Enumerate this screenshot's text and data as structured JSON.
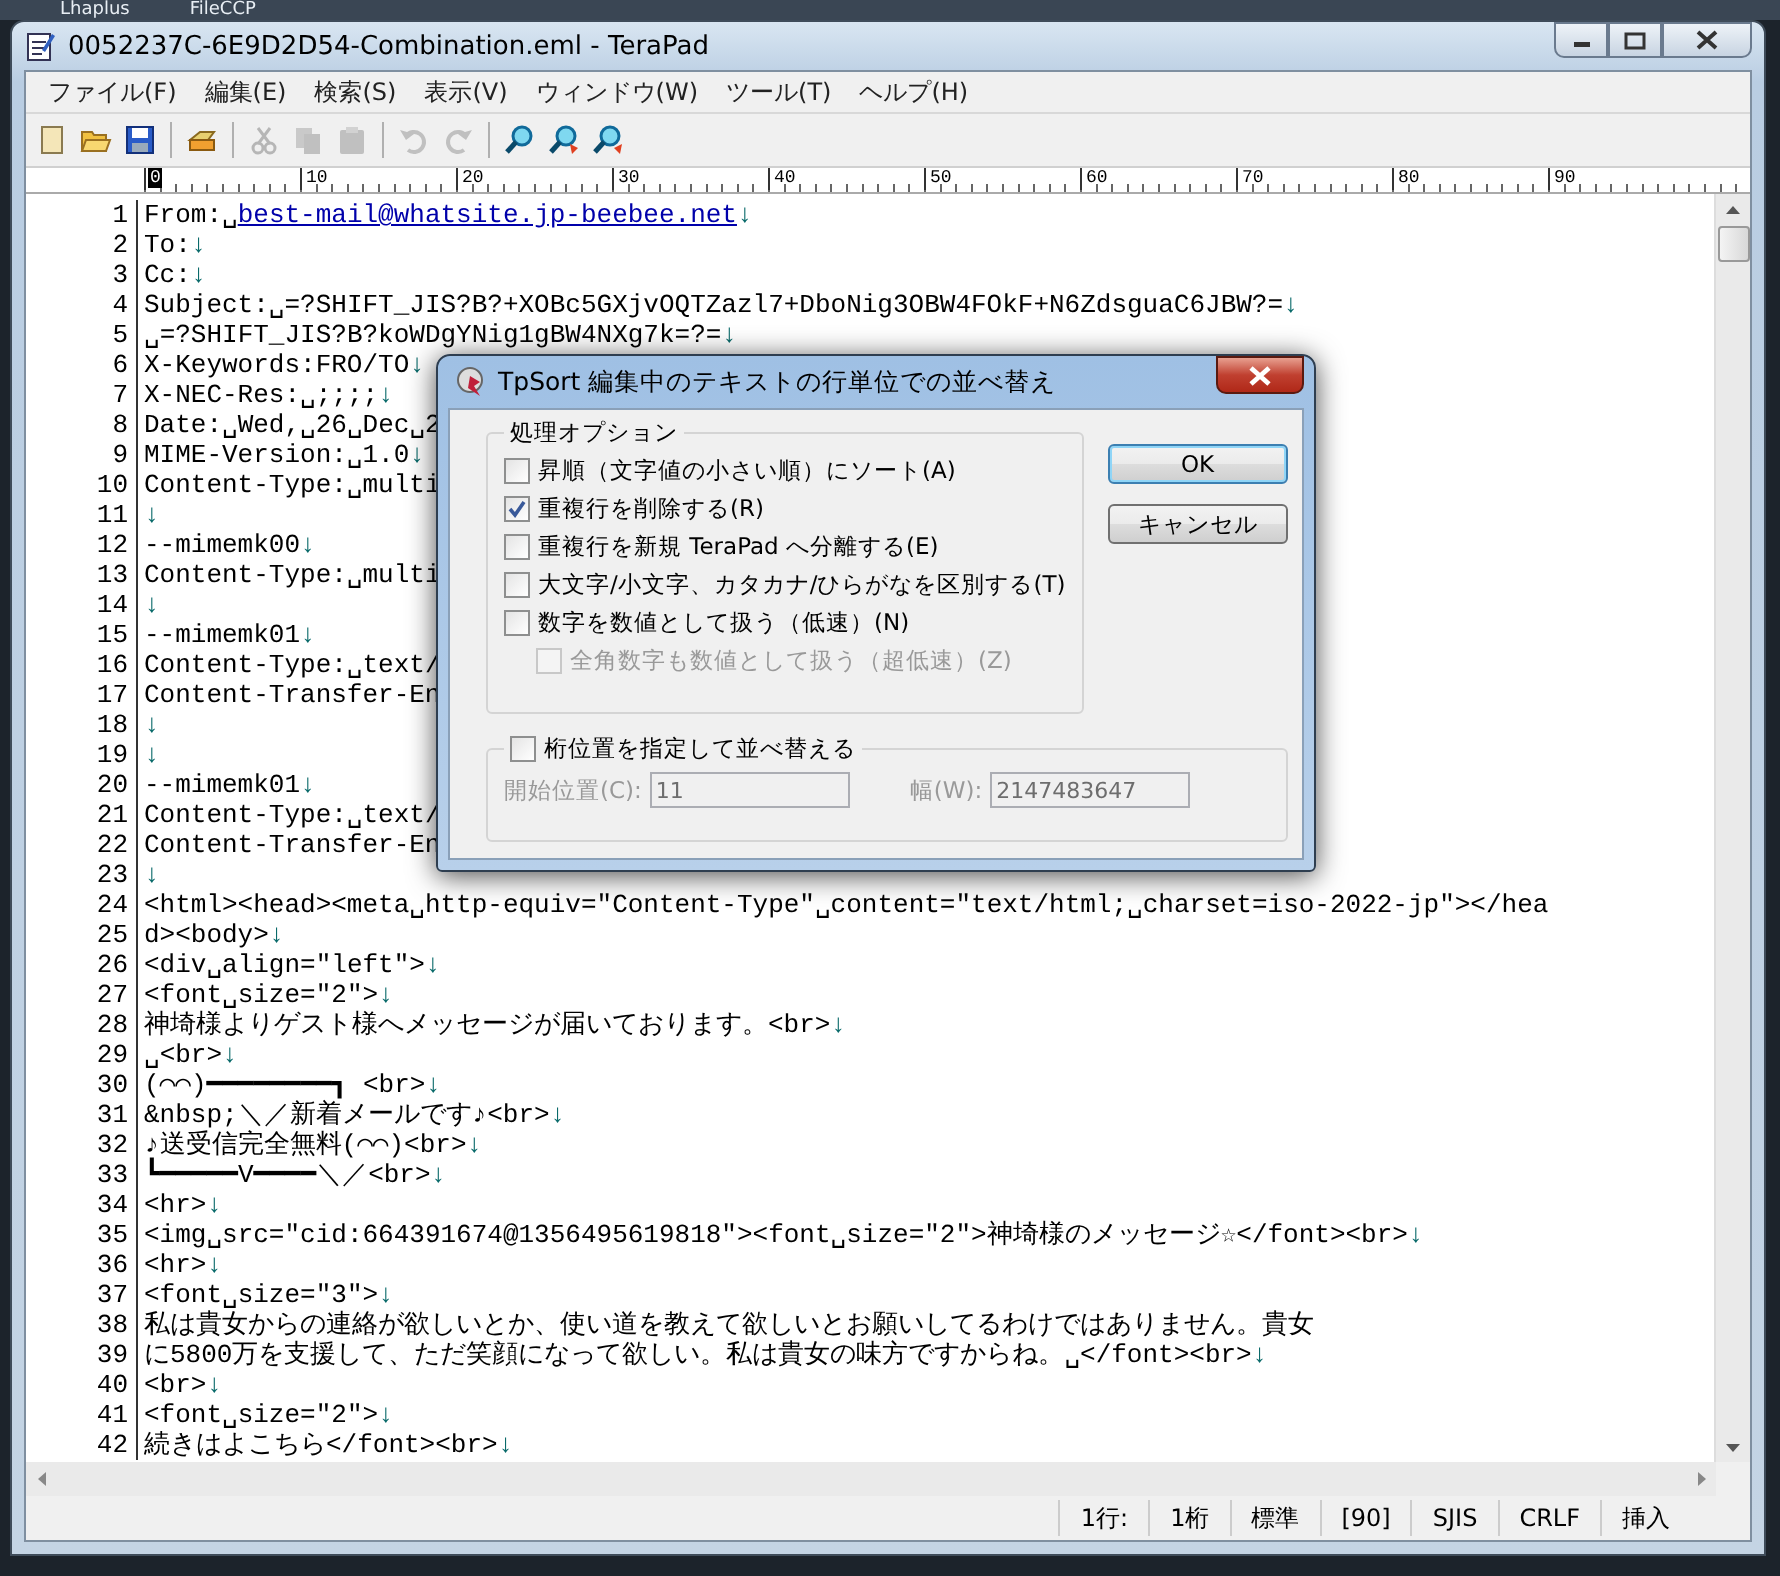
{
  "background_windows": [
    "Lhaplus",
    "FileCCP"
  ],
  "window": {
    "title": "0052237C-6E9D2D54-Combination.eml - TeraPad"
  },
  "menu": [
    "ファイル(F)",
    "編集(E)",
    "検索(S)",
    "表示(V)",
    "ウィンドウ(W)",
    "ツール(T)",
    "ヘルプ(H)"
  ],
  "toolbar": [
    {
      "kind": "new",
      "disabled": false
    },
    {
      "kind": "open",
      "disabled": false
    },
    {
      "kind": "save",
      "disabled": false
    },
    {
      "kind": "print",
      "disabled": false
    },
    {
      "kind": "cut",
      "disabled": true
    },
    {
      "kind": "copy",
      "disabled": true
    },
    {
      "kind": "paste",
      "disabled": true
    },
    {
      "kind": "undo",
      "disabled": true
    },
    {
      "kind": "redo",
      "disabled": true
    },
    {
      "kind": "find",
      "disabled": false
    },
    {
      "kind": "find-next",
      "disabled": false
    },
    {
      "kind": "find-prev",
      "disabled": false
    }
  ],
  "ruler": [
    {
      "label": "0",
      "selected": true
    },
    {
      "label": "10",
      "selected": false
    },
    {
      "label": "20",
      "selected": false
    },
    {
      "label": "30",
      "selected": false
    },
    {
      "label": "40",
      "selected": false
    },
    {
      "label": "50",
      "selected": false
    },
    {
      "label": "60",
      "selected": false
    },
    {
      "label": "70",
      "selected": false
    },
    {
      "label": "80",
      "selected": false
    },
    {
      "label": "90",
      "selected": false
    }
  ],
  "lines": [
    {
      "number": "1",
      "text": "From:␣",
      "link": "best-mail@whatsite.jp-beebee.net",
      "eol": "↓"
    },
    {
      "number": "2",
      "text": "To:",
      "eol": "↓"
    },
    {
      "number": "3",
      "text": "Cc:",
      "eol": "↓"
    },
    {
      "number": "4",
      "text": "Subject:␣=?SHIFT_JIS?B?+XOBc5GXjvOQTZazl7+DboNig3OBW4FOkF+N6ZdsguaC6JBW?=",
      "eol": "↓"
    },
    {
      "number": "5",
      "text": "␣=?SHIFT_JIS?B?koWDgYNig1gBW4NXg7k=?=",
      "eol": "↓"
    },
    {
      "number": "6",
      "text": "X-Keywords:FRO/TO",
      "eol": "↓"
    },
    {
      "number": "7",
      "text": "X-NEC-Res:␣;;;;",
      "eol": "↓"
    },
    {
      "number": "8",
      "text": "Date:␣Wed,␣26␣Dec␣2"
    },
    {
      "number": "9",
      "text": "MIME-Version:␣1.0",
      "eol": "↓"
    },
    {
      "number": "10",
      "text": "Content-Type:␣multi"
    },
    {
      "number": "11",
      "eol": "↓"
    },
    {
      "number": "12",
      "text": "--mimemk00",
      "eol": "↓"
    },
    {
      "number": "13",
      "text": "Content-Type:␣multi"
    },
    {
      "number": "14",
      "eol": "↓"
    },
    {
      "number": "15",
      "text": "--mimemk01",
      "eol": "↓"
    },
    {
      "number": "16",
      "text": "Content-Type:␣text/"
    },
    {
      "number": "17",
      "text": "Content-Transfer-En"
    },
    {
      "number": "18",
      "eol": "↓"
    },
    {
      "number": "19",
      "eol": "↓"
    },
    {
      "number": "20",
      "text": "--mimemk01",
      "eol": "↓"
    },
    {
      "number": "21",
      "text": "Content-Type:␣text/"
    },
    {
      "number": "22",
      "text": "Content-Transfer-En"
    },
    {
      "number": "23",
      "eol": "↓"
    },
    {
      "number": "24",
      "text": "<html><head><meta␣http-equiv=\"Content-Type\"␣content=\"text/html;␣charset=iso-2022-jp\"></hea"
    },
    {
      "number": "25",
      "text": "d><body>",
      "eol": "↓"
    },
    {
      "number": "26",
      "text": "<div␣align=\"left\">",
      "eol": "↓"
    },
    {
      "number": "27",
      "text": "<font␣size=\"2\">",
      "eol": "↓"
    },
    {
      "number": "28",
      "text": "神埼様よりゲスト様へメッセージが届いております。<br>",
      "eol": "↓"
    },
    {
      "number": "29",
      "text": "␣<br>",
      "eol": "↓"
    },
    {
      "number": "30",
      "text": "(⌒⌒)━━━━━━━━┓ <br>",
      "eol": "↓"
    },
    {
      "number": "31",
      "text": "&nbsp;＼／新着メールです♪<br>",
      "eol": "↓"
    },
    {
      "number": "32",
      "text": "♪送受信完全無料(⌒⌒)<br>",
      "eol": "↓"
    },
    {
      "number": "33",
      "text": "┗━━━━━V━━━━＼／<br>",
      "eol": "↓"
    },
    {
      "number": "34",
      "text": "<hr>",
      "eol": "↓"
    },
    {
      "number": "35",
      "text": "<img␣src=\"cid:664391674@1356495619818\"><font␣size=\"2\">神埼様のメッセージ☆</font><br>",
      "eol": "↓"
    },
    {
      "number": "36",
      "text": "<hr>",
      "eol": "↓"
    },
    {
      "number": "37",
      "text": "<font␣size=\"3\">",
      "eol": "↓"
    },
    {
      "number": "38",
      "text": "私は貴女からの連絡が欲しいとか、使い道を教えて欲しいとお願いしてるわけではありません。貴女"
    },
    {
      "number": "39",
      "text": "に5800万を支援して、ただ笑顔になって欲しい。私は貴女の味方ですからね。␣</font><br>",
      "eol": "↓"
    },
    {
      "number": "40",
      "text": "<br>",
      "eol": "↓"
    },
    {
      "number": "41",
      "text": "<font␣size=\"2\">",
      "eol": "↓"
    },
    {
      "number": "42",
      "text": "続きはよこちら</font><br>",
      "eol": "↓"
    }
  ],
  "status_bar": [
    "1行:",
    "1桁",
    "標準",
    "[90]",
    "SJIS",
    "CRLF",
    "挿入"
  ],
  "dialog": {
    "title": "TpSort 編集中のテキストの行単位での並べ替え",
    "options_group": {
      "label": "処理オプション",
      "options": [
        {
          "label": "昇順（文字値の小さい順）にソート(A)",
          "checked": false,
          "disabled": false
        },
        {
          "label": "重複行を削除する(R)",
          "checked": true,
          "disabled": false
        },
        {
          "label": "重複行を新規 TeraPad へ分離する(E)",
          "checked": false,
          "disabled": false
        },
        {
          "label": "大文字/小文字、カタカナ/ひらがなを区別する(T)",
          "checked": false,
          "disabled": false
        },
        {
          "label": "数字を数値として扱う（低速）(N)",
          "checked": false,
          "disabled": false,
          "children": [
            {
              "label": "全角数字も数値として扱う（超低速）(Z)",
              "checked": false,
              "disabled": true
            }
          ]
        }
      ]
    },
    "position_group": {
      "label": "桁位置を指定して並べ替える",
      "checked": false,
      "fields": [
        {
          "label": "開始位置(C):",
          "value": "11",
          "disabled": true
        },
        {
          "label": "幅(W):",
          "value": "2147483647",
          "disabled": true
        }
      ]
    },
    "buttons": [
      "OK",
      "キャンセル"
    ]
  }
}
